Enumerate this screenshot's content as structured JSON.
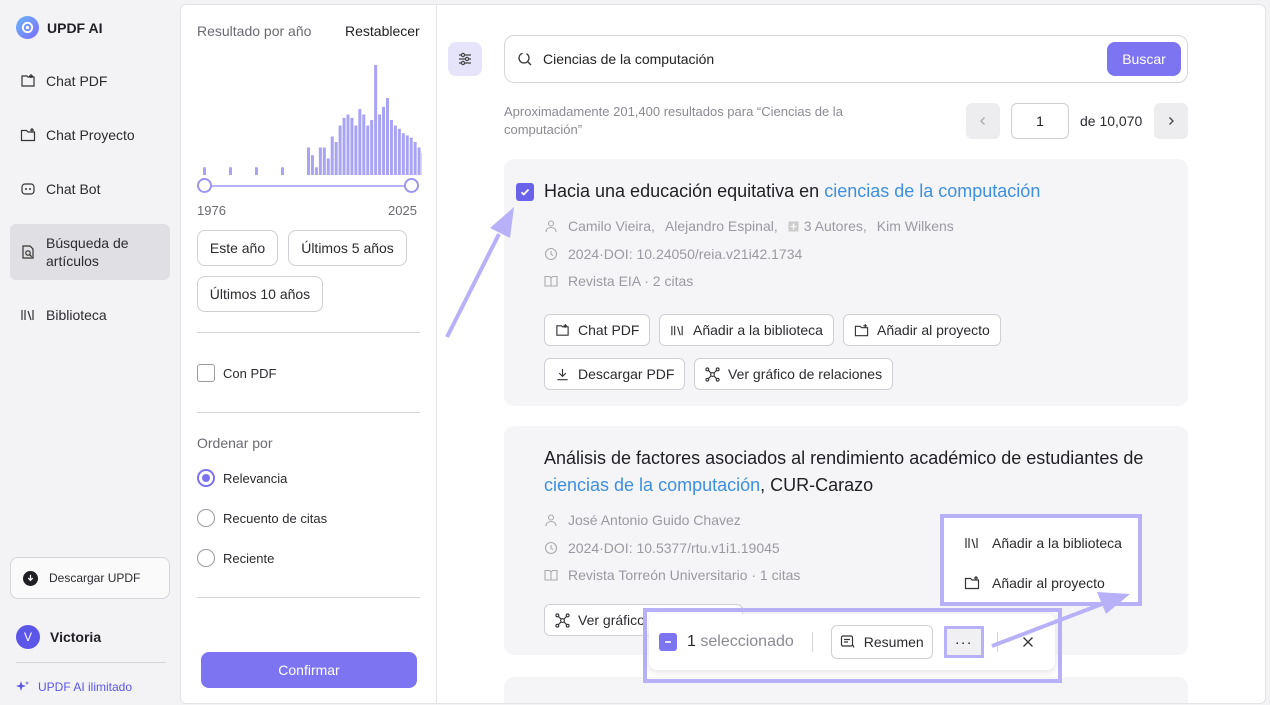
{
  "app": {
    "name": "UPDF AI"
  },
  "nav": {
    "items": [
      {
        "label": "Chat PDF"
      },
      {
        "label": "Chat Proyecto"
      },
      {
        "label": "Chat Bot"
      },
      {
        "label": "Búsqueda de artículos"
      },
      {
        "label": "Biblioteca"
      }
    ],
    "download_label": "Descargar UPDF",
    "user_name": "Victoria",
    "user_initial": "V",
    "unlimited_label": "UPDF AI ilimitado"
  },
  "filter": {
    "year_title": "Resultado por año",
    "reset_label": "Restablecer",
    "year_min": "1976",
    "year_max": "2025",
    "histogram": [
      0.07,
      0.07,
      0.07,
      0.07,
      0.07,
      0.25,
      0.18,
      0.07,
      0.25,
      0.25,
      0.15,
      0.35,
      0.3,
      0.45,
      0.52,
      0.55,
      0.52,
      0.45,
      0.6,
      0.55,
      0.45,
      0.5,
      1.0,
      0.55,
      0.62,
      0.7,
      0.5,
      0.45,
      0.42,
      0.38,
      0.36,
      0.34,
      0.3,
      0.25,
      0.2
    ],
    "chips": [
      "Este año",
      "Últimos 5 años",
      "Últimos 10 años"
    ],
    "with_pdf_label": "Con PDF",
    "with_pdf_checked": false,
    "sort_title": "Ordenar por",
    "sort_options": [
      "Relevancia",
      "Recuento de citas",
      "Reciente"
    ],
    "sort_selected": "Relevancia",
    "confirm_label": "Confirmar"
  },
  "search": {
    "query": "Ciencias de la computación",
    "button_label": "Buscar",
    "results_text": "Aproximadamente 201,400 resultados para “Ciencias de la computación”",
    "page": "1",
    "page_total": "de 10,070"
  },
  "results": [
    {
      "checked": true,
      "title_pre": "Hacia una educación equitativa en ",
      "title_hl": "ciencias de la computación",
      "title_post": "",
      "authors": [
        "Camilo Vieira,",
        "Alejandro Espinal,",
        "3 Autores,",
        "Kim Wilkens"
      ],
      "doi": "2024·DOI: 10.24050/reia.v21i42.1734",
      "venue": "Revista EIA · 2 citas",
      "actions": [
        "Chat PDF",
        "Añadir a la biblioteca",
        "Añadir al proyecto",
        "Descargar PDF",
        "Ver gráfico de relaciones"
      ]
    },
    {
      "checked": false,
      "title_pre": "Análisis de factores asociados al rendimiento académico de estudiantes de ",
      "title_hl": "ciencias de la computación",
      "title_post": ", CUR-Carazo",
      "authors": [
        "José Antonio Guido Chavez"
      ],
      "doi": "2024·DOI: 10.5377/rtu.v1i1.19045",
      "venue": "Revista Torreón Universitario · 1 citas",
      "actions": [
        "Ver gráfico de relaciones"
      ]
    }
  ],
  "dropdown": {
    "items": [
      "Añadir a la biblioteca",
      "Añadir al proyecto"
    ]
  },
  "selection": {
    "count": "1",
    "label": "seleccionado",
    "summary_label": "Resumen",
    "more_label": "···"
  },
  "colors": {
    "accent": "#7c74f0",
    "highlight_link": "#3d8fe0",
    "annotation": "#b8b1f7"
  }
}
